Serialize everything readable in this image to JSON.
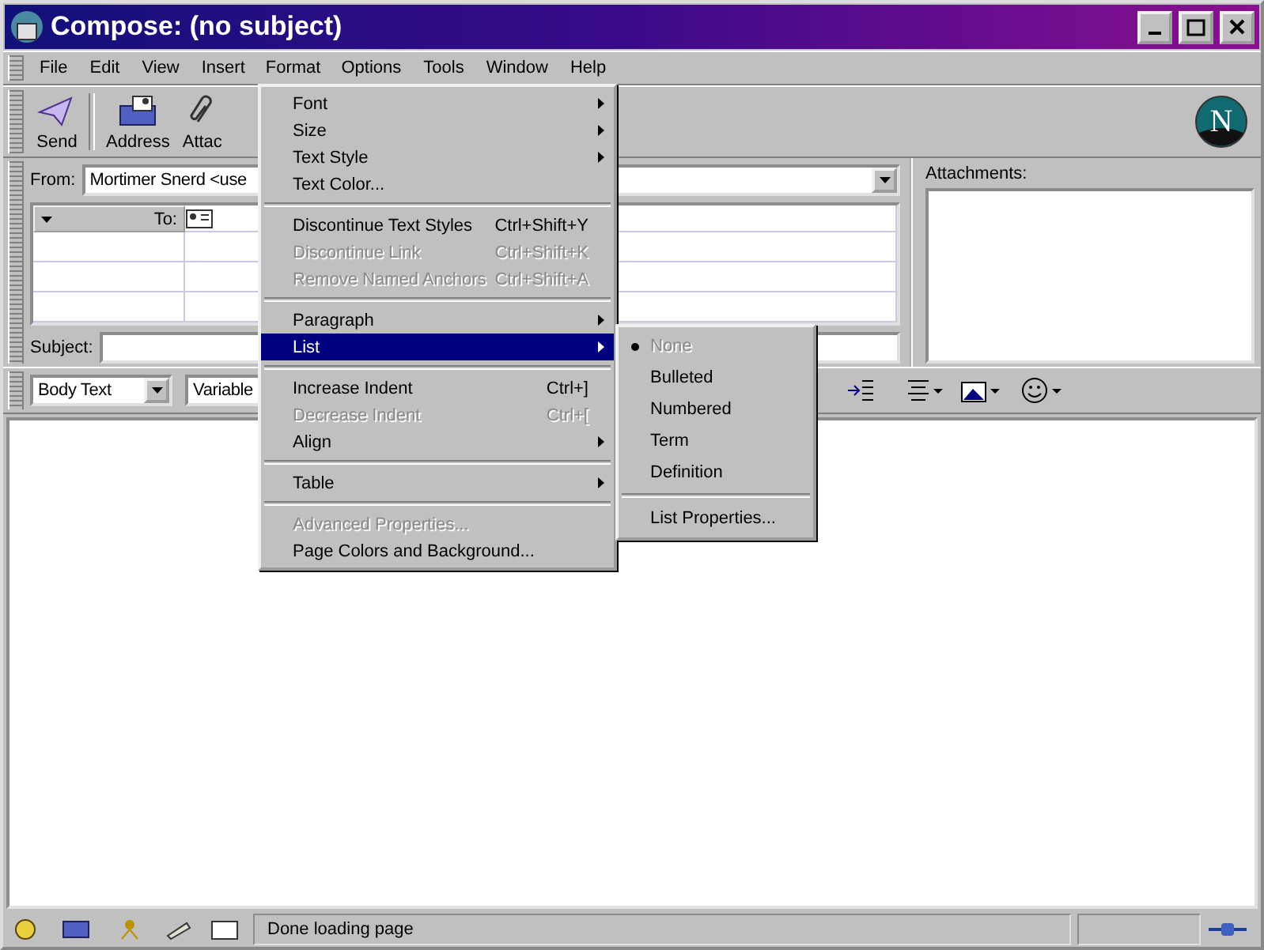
{
  "window": {
    "title": "Compose: (no subject)"
  },
  "menu_bar": [
    {
      "label": "File",
      "selected": false
    },
    {
      "label": "Edit",
      "selected": false
    },
    {
      "label": "View",
      "selected": false
    },
    {
      "label": "Insert",
      "selected": false
    },
    {
      "label": "Format",
      "selected": true
    },
    {
      "label": "Options",
      "selected": false
    },
    {
      "label": "Tools",
      "selected": false
    },
    {
      "label": "Window",
      "selected": false
    },
    {
      "label": "Help",
      "selected": false
    }
  ],
  "toolbar": [
    {
      "kind": "send",
      "label": "Send"
    },
    {
      "kind": "address",
      "label": "Address"
    },
    {
      "kind": "attach",
      "label": "Attac"
    }
  ],
  "logo": {
    "letter": "N"
  },
  "address": {
    "from_label": "From:",
    "from_value": "Mortimer Snerd <use",
    "to_label": "To:",
    "subject_label": "Subject:",
    "attachments_label": "Attachments:"
  },
  "format_toolbar": {
    "paragraph_style": "Body Text",
    "font": "Variable"
  },
  "format_menu": [
    {
      "kind": "item",
      "label": "Font",
      "submenu": true,
      "disabled": false,
      "selected": false
    },
    {
      "kind": "item",
      "label": "Size",
      "submenu": true,
      "disabled": false,
      "selected": false
    },
    {
      "kind": "item",
      "label": "Text Style",
      "submenu": true,
      "disabled": false,
      "selected": false
    },
    {
      "kind": "item",
      "label": "Text Color...",
      "submenu": false,
      "disabled": false,
      "selected": false
    },
    {
      "kind": "separator"
    },
    {
      "kind": "item",
      "label": "Discontinue Text Styles",
      "shortcut": "Ctrl+Shift+Y",
      "submenu": false,
      "disabled": false,
      "selected": false
    },
    {
      "kind": "item",
      "label": "Discontinue Link",
      "shortcut": "Ctrl+Shift+K",
      "submenu": false,
      "disabled": true,
      "selected": false
    },
    {
      "kind": "item",
      "label": "Remove Named Anchors",
      "shortcut": "Ctrl+Shift+A",
      "submenu": false,
      "disabled": true,
      "selected": false
    },
    {
      "kind": "separator"
    },
    {
      "kind": "item",
      "label": "Paragraph",
      "submenu": true,
      "disabled": false,
      "selected": false
    },
    {
      "kind": "item",
      "label": "List",
      "submenu": true,
      "disabled": false,
      "selected": true
    },
    {
      "kind": "separator"
    },
    {
      "kind": "item",
      "label": "Increase Indent",
      "shortcut": "Ctrl+]",
      "submenu": false,
      "disabled": false,
      "selected": false
    },
    {
      "kind": "item",
      "label": "Decrease Indent",
      "shortcut": "Ctrl+[",
      "submenu": false,
      "disabled": true,
      "selected": false
    },
    {
      "kind": "item",
      "label": "Align",
      "submenu": true,
      "disabled": false,
      "selected": false
    },
    {
      "kind": "separator"
    },
    {
      "kind": "item",
      "label": "Table",
      "submenu": true,
      "disabled": false,
      "selected": false
    },
    {
      "kind": "separator"
    },
    {
      "kind": "item",
      "label": "Advanced Properties...",
      "submenu": false,
      "disabled": true,
      "selected": false
    },
    {
      "kind": "item",
      "label": "Page Colors and Background...",
      "submenu": false,
      "disabled": false,
      "selected": false
    }
  ],
  "list_submenu": [
    {
      "kind": "item",
      "label": "None",
      "checked": true,
      "disabled": true
    },
    {
      "kind": "item",
      "label": "Bulleted",
      "checked": false,
      "disabled": false
    },
    {
      "kind": "item",
      "label": "Numbered",
      "checked": false,
      "disabled": false
    },
    {
      "kind": "item",
      "label": "Term",
      "checked": false,
      "disabled": false
    },
    {
      "kind": "item",
      "label": "Definition",
      "checked": false,
      "disabled": false
    },
    {
      "kind": "separator"
    },
    {
      "kind": "item",
      "label": "List Properties...",
      "checked": false,
      "disabled": false
    }
  ],
  "status_bar": {
    "text": "Done loading page"
  }
}
